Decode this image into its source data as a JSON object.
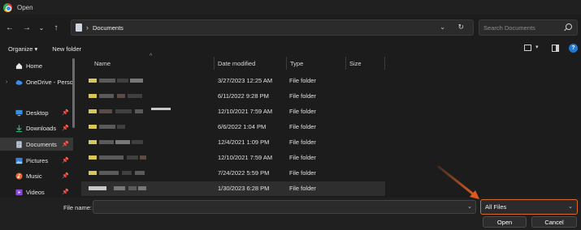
{
  "window": {
    "title": "Open"
  },
  "address": {
    "path": "Documents"
  },
  "search": {
    "placeholder": "Search Documents"
  },
  "toolbar": {
    "organize": "Organize ▾",
    "new_folder": "New folder"
  },
  "columns": {
    "name": "Name",
    "date": "Date modified",
    "type": "Type",
    "size": "Size"
  },
  "sidebar": {
    "items": [
      {
        "label": "Home",
        "icon": "home-icon"
      },
      {
        "label": "OneDrive - Perso",
        "icon": "cloud-icon"
      },
      {
        "label": "Desktop",
        "icon": "desktop-icon"
      },
      {
        "label": "Downloads",
        "icon": "download-icon"
      },
      {
        "label": "Documents",
        "icon": "document-icon"
      },
      {
        "label": "Pictures",
        "icon": "picture-icon"
      },
      {
        "label": "Music",
        "icon": "music-icon"
      },
      {
        "label": "Videos",
        "icon": "video-icon"
      }
    ]
  },
  "files": [
    {
      "date": "3/27/2023 12:25 AM",
      "type": "File folder"
    },
    {
      "date": "6/11/2022 9:28 PM",
      "type": "File folder"
    },
    {
      "date": "12/10/2021 7:59 AM",
      "type": "File folder"
    },
    {
      "date": "6/6/2022 1:04 PM",
      "type": "File folder"
    },
    {
      "date": "12/4/2021 1:09 PM",
      "type": "File folder"
    },
    {
      "date": "12/10/2021 7:59 AM",
      "type": "File folder"
    },
    {
      "date": "7/24/2022 5:59 PM",
      "type": "File folder"
    },
    {
      "date": "1/30/2023 6:28 PM",
      "type": "File folder"
    }
  ],
  "footer": {
    "file_name_label": "File name:",
    "file_name_value": "",
    "file_type": "All Files",
    "open": "Open",
    "cancel": "Cancel"
  },
  "colors": {
    "accent": "#1e7ad3",
    "highlight": "#d76a28",
    "folder": "#d8c65a"
  }
}
